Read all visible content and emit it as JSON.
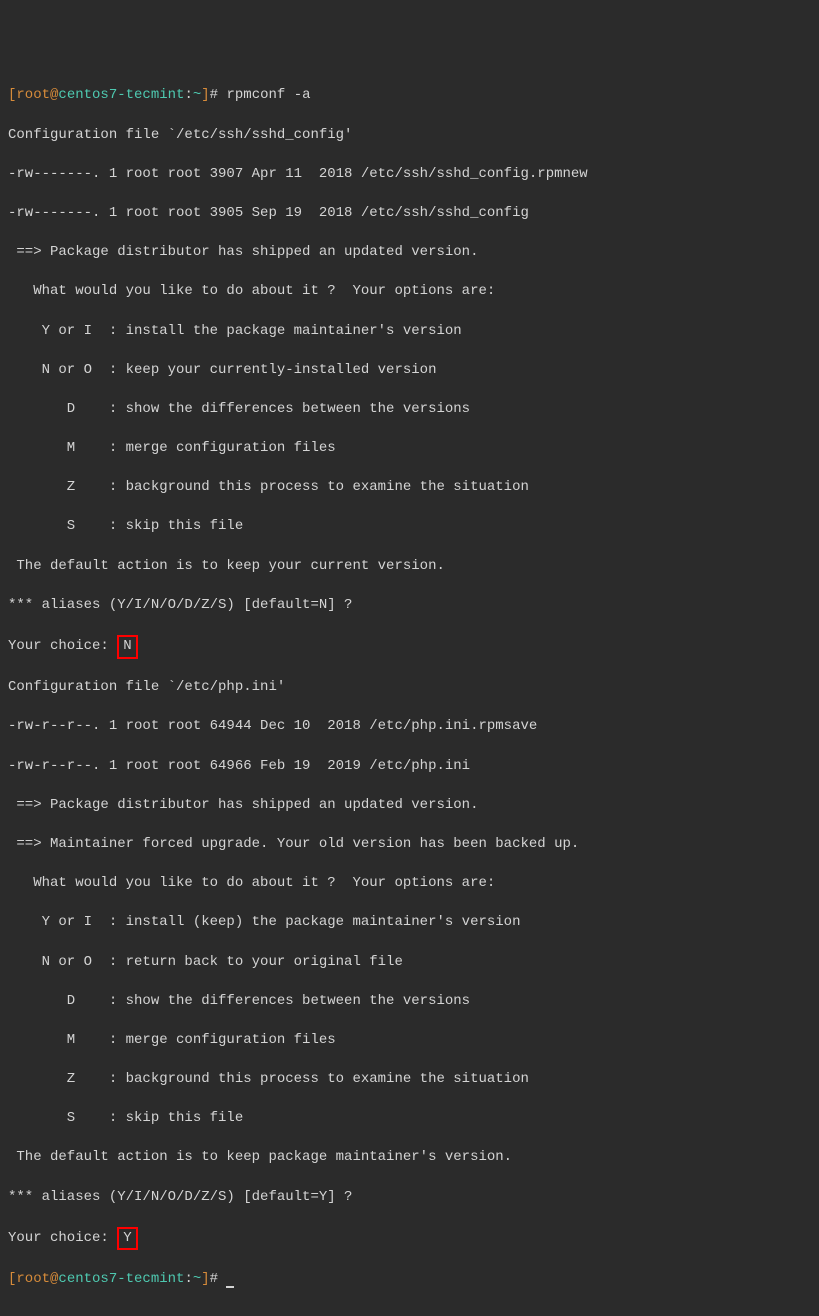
{
  "prompt1": {
    "bracket_open": "[",
    "user": "root",
    "at": "@",
    "host": "centos7-tecmint",
    "colon": ":",
    "path": "~",
    "bracket_close": "]",
    "hash": "# ",
    "command": "rpmconf -a"
  },
  "block1": {
    "line1": "Configuration file `/etc/ssh/sshd_config'",
    "line2": "-rw-------. 1 root root 3907 Apr 11  2018 /etc/ssh/sshd_config.rpmnew",
    "line3": "-rw-------. 1 root root 3905 Sep 19  2018 /etc/ssh/sshd_config",
    "line4": " ==> Package distributor has shipped an updated version.",
    "line5": "   What would you like to do about it ?  Your options are:",
    "line6": "    Y or I  : install the package maintainer's version",
    "line7": "    N or O  : keep your currently-installed version",
    "line8": "       D    : show the differences between the versions",
    "line9": "       M    : merge configuration files",
    "line10": "       Z    : background this process to examine the situation",
    "line11": "       S    : skip this file",
    "line12": " The default action is to keep your current version.",
    "line13": "*** aliases (Y/I/N/O/D/Z/S) [default=N] ?",
    "line14_prefix": "Your choice: ",
    "line14_input": "N"
  },
  "block2": {
    "line1": "Configuration file `/etc/php.ini'",
    "line2": "-rw-r--r--. 1 root root 64944 Dec 10  2018 /etc/php.ini.rpmsave",
    "line3": "-rw-r--r--. 1 root root 64966 Feb 19  2019 /etc/php.ini",
    "line4": " ==> Package distributor has shipped an updated version.",
    "line5": " ==> Maintainer forced upgrade. Your old version has been backed up.",
    "line6": "   What would you like to do about it ?  Your options are:",
    "line7": "    Y or I  : install (keep) the package maintainer's version",
    "line8": "    N or O  : return back to your original file",
    "line9": "       D    : show the differences between the versions",
    "line10": "       M    : merge configuration files",
    "line11": "       Z    : background this process to examine the situation",
    "line12": "       S    : skip this file",
    "line13": " The default action is to keep package maintainer's version.",
    "line14": "*** aliases (Y/I/N/O/D/Z/S) [default=Y] ?",
    "line15_prefix": "Your choice: ",
    "line15_input": "Y"
  },
  "prompt2": {
    "bracket_open": "[",
    "user": "root",
    "at": "@",
    "host": "centos7-tecmint",
    "colon": ":",
    "path": "~",
    "bracket_close": "]",
    "hash": "# "
  }
}
